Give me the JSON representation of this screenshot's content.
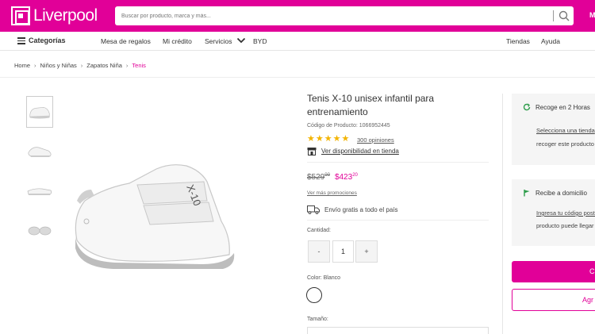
{
  "header": {
    "logo_text": "Liverpool",
    "search_placeholder": "Buscar por producto, marca y más...",
    "user_initial": "M",
    "brand_color": "#e10098"
  },
  "nav": {
    "categories_label": "Categorías",
    "links": [
      "Mesa de regalos",
      "Mi crédito",
      "Servicios",
      "BYD"
    ],
    "right_links": [
      "Tiendas",
      "Ayuda"
    ]
  },
  "breadcrumb": [
    "Home",
    "Niños y Niñas",
    "Zapatos Niña",
    "Tenis"
  ],
  "product": {
    "title": "Tenis X-10 unisex infantil para entrenamiento",
    "code": "Código de Producto: 1066952445",
    "rating": 5,
    "reviews": "300 opiniones",
    "store_link": "Ver disponibilidad en tienda",
    "old_price": "$529",
    "old_price_cents": "00",
    "new_price": "$423",
    "new_price_cents": "20",
    "promo_link": "Ver más promociones",
    "shipping_text": "Envío gratis a todo el país",
    "quantity_label": "Cantidad:",
    "quantity_minus": "-",
    "quantity_value": "1",
    "quantity_plus": "+",
    "color_label": "Color: Blanco",
    "size_label": "Tamaño:"
  },
  "side": {
    "pickup": {
      "title": "Recoge en 2 Horas",
      "line1": "Selecciona una tienda",
      "line2": "recoger este producto"
    },
    "delivery": {
      "title": "Recibe a domicilio",
      "line1": "Ingresa tu código postal",
      "line2": "producto puede llegar"
    },
    "cta_label": "C",
    "add_label": "Agr"
  }
}
